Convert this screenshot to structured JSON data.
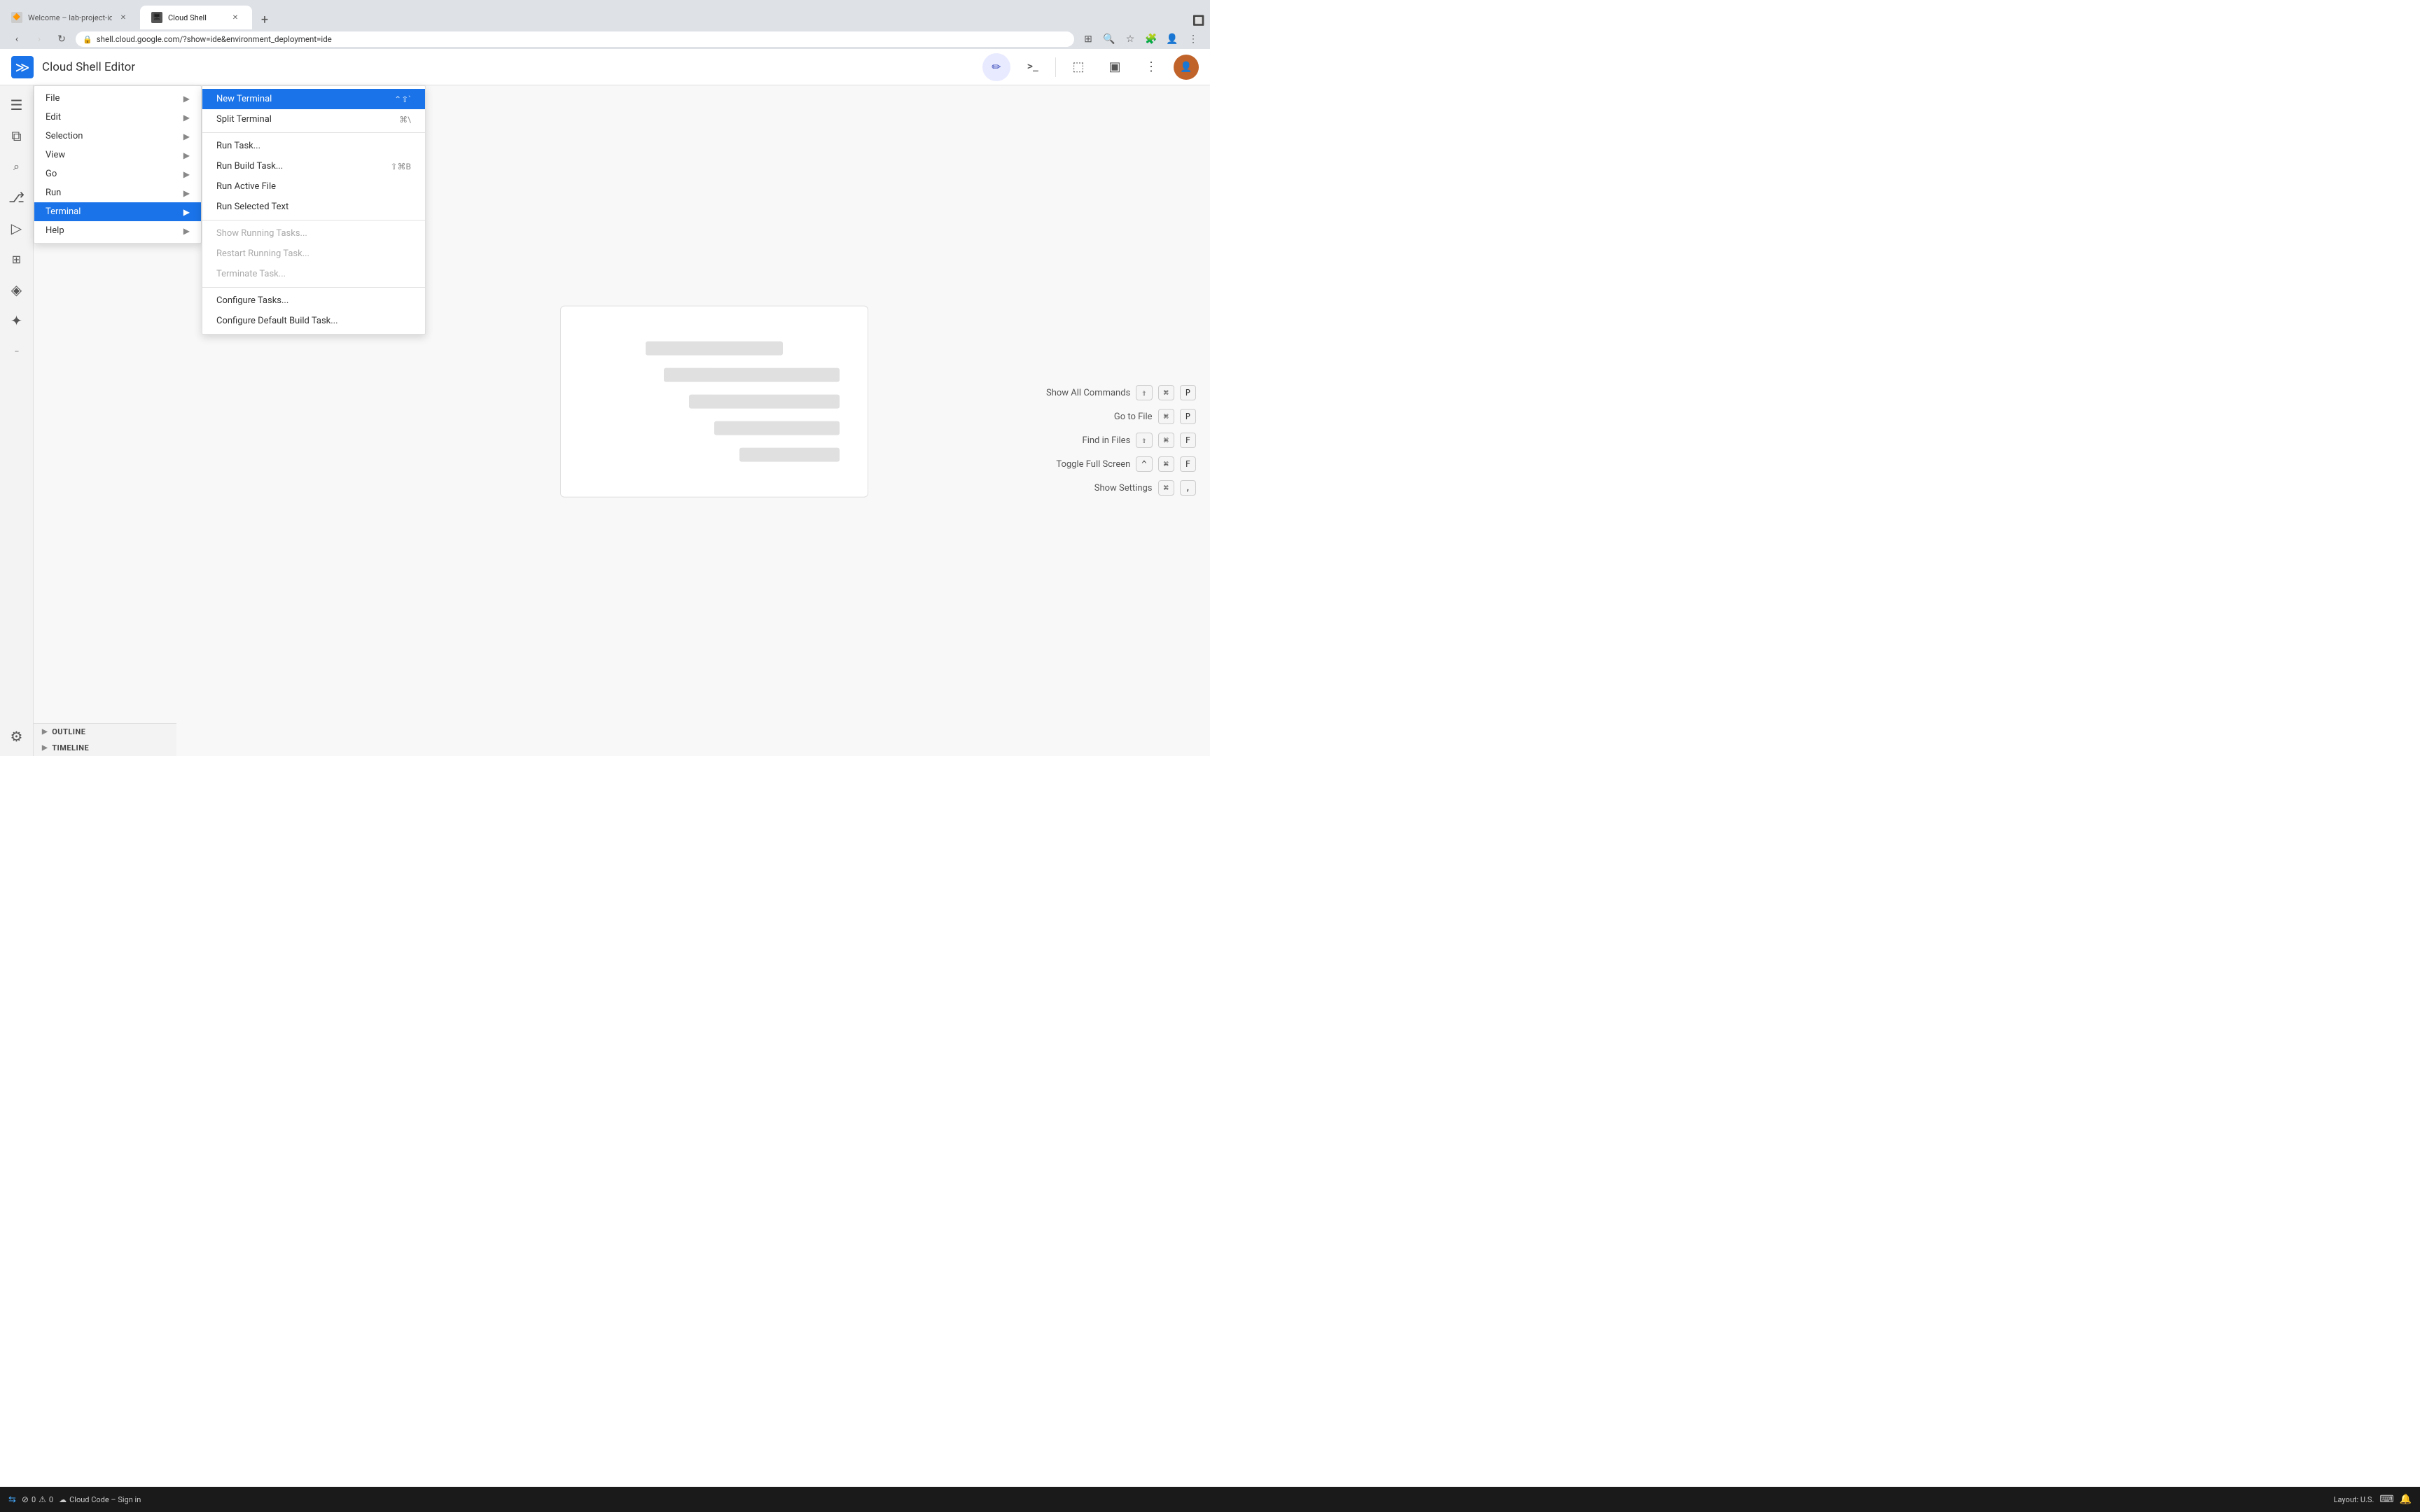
{
  "browser": {
    "tabs": [
      {
        "id": "tab-1",
        "label": "Welcome – lab-project-id-e...",
        "favicon": "🔶",
        "active": false
      },
      {
        "id": "tab-2",
        "label": "Cloud Shell",
        "favicon": "🖥",
        "active": true
      }
    ],
    "address": "shell.cloud.google.com/?show=ide&environment_deployment=ide",
    "new_tab_label": "+"
  },
  "app": {
    "logo": "≫",
    "title": "Cloud Shell Editor",
    "header_actions": [
      {
        "id": "edit-btn",
        "icon": "✏️",
        "active": true
      },
      {
        "id": "terminal-btn",
        "icon": ">_",
        "active": false
      },
      {
        "id": "preview-btn",
        "icon": "⬚",
        "active": false
      },
      {
        "id": "layout-btn",
        "icon": "▣",
        "active": false
      },
      {
        "id": "more-btn",
        "icon": "⋮",
        "active": false
      }
    ]
  },
  "activity_bar": {
    "items": [
      {
        "id": "menu",
        "icon": "☰",
        "label": "Menu"
      },
      {
        "id": "explorer",
        "icon": "⧉",
        "label": "Explorer"
      },
      {
        "id": "search",
        "icon": "🔍",
        "label": "Search"
      },
      {
        "id": "source-control",
        "icon": "⎇",
        "label": "Source Control"
      },
      {
        "id": "run",
        "icon": "▷",
        "label": "Run and Debug"
      },
      {
        "id": "extensions",
        "icon": "⊞",
        "label": "Extensions"
      },
      {
        "id": "cloud-code",
        "icon": "◈",
        "label": "Cloud Code"
      },
      {
        "id": "gemini",
        "icon": "✦",
        "label": "Gemini"
      },
      {
        "id": "more",
        "icon": "···",
        "label": "More"
      }
    ],
    "bottom_items": [
      {
        "id": "settings",
        "icon": "⚙",
        "label": "Settings"
      }
    ]
  },
  "menu": {
    "items": [
      {
        "id": "file",
        "label": "File",
        "has_arrow": true
      },
      {
        "id": "edit",
        "label": "Edit",
        "has_arrow": true
      },
      {
        "id": "selection",
        "label": "Selection",
        "has_arrow": true
      },
      {
        "id": "view",
        "label": "View",
        "has_arrow": true
      },
      {
        "id": "go",
        "label": "Go",
        "has_arrow": true
      },
      {
        "id": "run",
        "label": "Run",
        "has_arrow": true
      },
      {
        "id": "terminal",
        "label": "Terminal",
        "has_arrow": true,
        "active": true
      },
      {
        "id": "help",
        "label": "Help",
        "has_arrow": true
      }
    ],
    "submenu": {
      "parent": "terminal",
      "items": [
        {
          "id": "new-terminal",
          "label": "New Terminal",
          "shortcut": "⌃⇧`",
          "active": true,
          "disabled": false
        },
        {
          "id": "split-terminal",
          "label": "Split Terminal",
          "shortcut": "⌘\\",
          "active": false,
          "disabled": false
        },
        {
          "id": "divider1",
          "type": "divider"
        },
        {
          "id": "run-task",
          "label": "Run Task...",
          "shortcut": "",
          "active": false,
          "disabled": false
        },
        {
          "id": "run-build-task",
          "label": "Run Build Task...",
          "shortcut": "⇧⌘B",
          "active": false,
          "disabled": false
        },
        {
          "id": "run-active-file",
          "label": "Run Active File",
          "shortcut": "",
          "active": false,
          "disabled": false
        },
        {
          "id": "run-selected-text",
          "label": "Run Selected Text",
          "shortcut": "",
          "active": false,
          "disabled": false
        },
        {
          "id": "divider2",
          "type": "divider"
        },
        {
          "id": "show-running-tasks",
          "label": "Show Running Tasks...",
          "shortcut": "",
          "active": false,
          "disabled": true
        },
        {
          "id": "restart-running-task",
          "label": "Restart Running Task...",
          "shortcut": "",
          "active": false,
          "disabled": true
        },
        {
          "id": "terminate-task",
          "label": "Terminate Task...",
          "shortcut": "",
          "active": false,
          "disabled": true
        },
        {
          "id": "divider3",
          "type": "divider"
        },
        {
          "id": "configure-tasks",
          "label": "Configure Tasks...",
          "shortcut": "",
          "active": false,
          "disabled": false
        },
        {
          "id": "configure-default-build",
          "label": "Configure Default Build Task...",
          "shortcut": "",
          "active": false,
          "disabled": false
        }
      ]
    }
  },
  "welcome": {
    "placeholders": [
      {
        "width": "55%",
        "align": "center"
      },
      {
        "width": "70%"
      },
      {
        "width": "60%"
      },
      {
        "width": "50%"
      },
      {
        "width": "40%"
      }
    ]
  },
  "command_palette": {
    "items": [
      {
        "label": "Show All Commands",
        "keys": [
          "⇧",
          "⌘",
          "P"
        ]
      },
      {
        "label": "Go to File",
        "keys": [
          "⌘",
          "P"
        ]
      },
      {
        "label": "Find in Files",
        "keys": [
          "⇧",
          "⌘",
          "F"
        ]
      },
      {
        "label": "Toggle Full Screen",
        "keys": [
          "^",
          "⌘",
          "F"
        ]
      },
      {
        "label": "Show Settings",
        "keys": [
          "⌘",
          ","
        ]
      }
    ]
  },
  "sidebar_sections": [
    {
      "id": "outline",
      "label": "OUTLINE"
    },
    {
      "id": "timeline",
      "label": "TIMELINE"
    }
  ],
  "status_bar": {
    "errors": "0",
    "warnings": "0",
    "cloud_code": "Cloud Code – Sign in",
    "layout": "Layout: U.S."
  }
}
